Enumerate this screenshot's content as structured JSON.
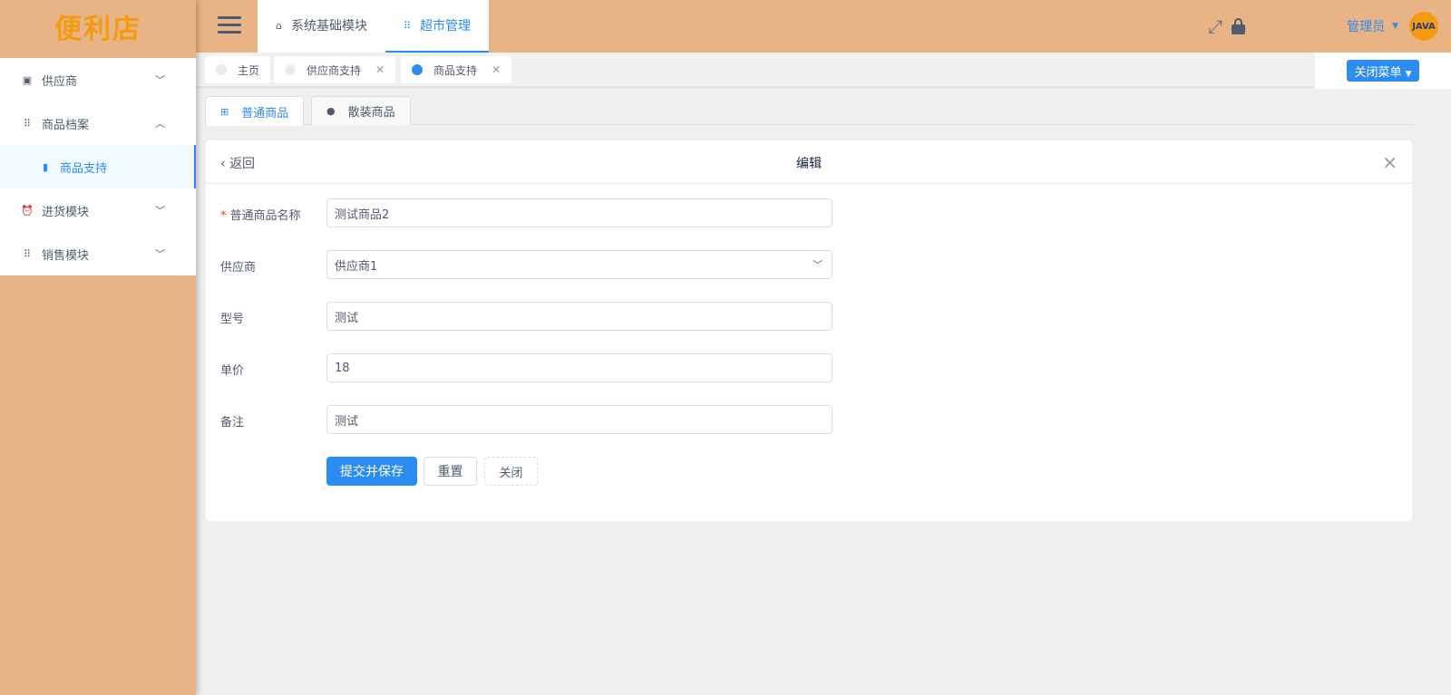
{
  "logo": "便利店",
  "sidebar": {
    "items": [
      {
        "label": "供应商",
        "icon": "archive-icon"
      },
      {
        "label": "商品档案",
        "icon": "grid-icon"
      },
      {
        "label": "商品支持",
        "icon": "trash-icon"
      },
      {
        "label": "进货模块",
        "icon": "alarm-icon"
      },
      {
        "label": "销售模块",
        "icon": "grid-icon"
      }
    ]
  },
  "header": {
    "nav": [
      "系统基础模块",
      "超市管理"
    ],
    "user": "管理员",
    "avatar_text": "JAVA"
  },
  "tags": [
    "主页",
    "供应商支持",
    "商品支持"
  ],
  "close_menu": "关闭菜单",
  "subtabs": [
    "普通商品",
    "散装商品"
  ],
  "card": {
    "back": "返回",
    "title": "编辑"
  },
  "form": {
    "fields": [
      {
        "label": "普通商品名称",
        "value": "测试商品2"
      },
      {
        "label": "供应商",
        "value": "供应商1"
      },
      {
        "label": "型号",
        "value": "测试"
      },
      {
        "label": "单价",
        "value": "18"
      },
      {
        "label": "备注",
        "value": "测试"
      }
    ],
    "submit": "提交并保存",
    "reset": "重置",
    "close": "关闭"
  },
  "colors": {
    "brand": "#e8b485",
    "accent": "#2d8cf0"
  }
}
